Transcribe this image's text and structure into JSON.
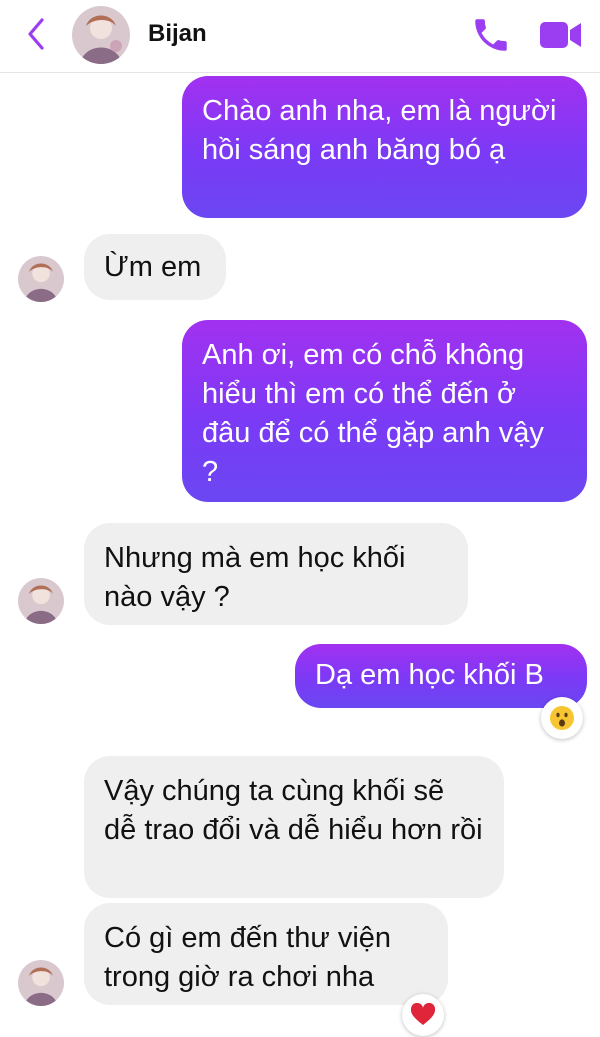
{
  "header": {
    "contact_name": "Bijan",
    "accent_color": "#a231f0"
  },
  "messages": [
    {
      "direction": "sent",
      "text": "Chào anh nha, em là người hồi sáng anh băng bó ạ"
    },
    {
      "direction": "received",
      "text": "Ừm em"
    },
    {
      "direction": "sent",
      "text": "Anh ơi, em có chỗ không hiểu thì em có thể đến ở đâu để có thể gặp anh vậy ?"
    },
    {
      "direction": "received",
      "text": "Nhưng mà em học khối nào vậy ?"
    },
    {
      "direction": "sent",
      "text": "Dạ em học khối B",
      "reaction": "surprised-face"
    },
    {
      "direction": "received",
      "text": "Vậy chúng ta cùng khối sẽ dễ trao đổi và dễ hiểu hơn rồi"
    },
    {
      "direction": "received",
      "text": "Có gì em đến thư viện trong giờ ra chơi nha",
      "reaction": "red-heart"
    }
  ],
  "icons": {
    "back": "chevron-left-icon",
    "call": "phone-icon",
    "video": "video-camera-icon"
  }
}
